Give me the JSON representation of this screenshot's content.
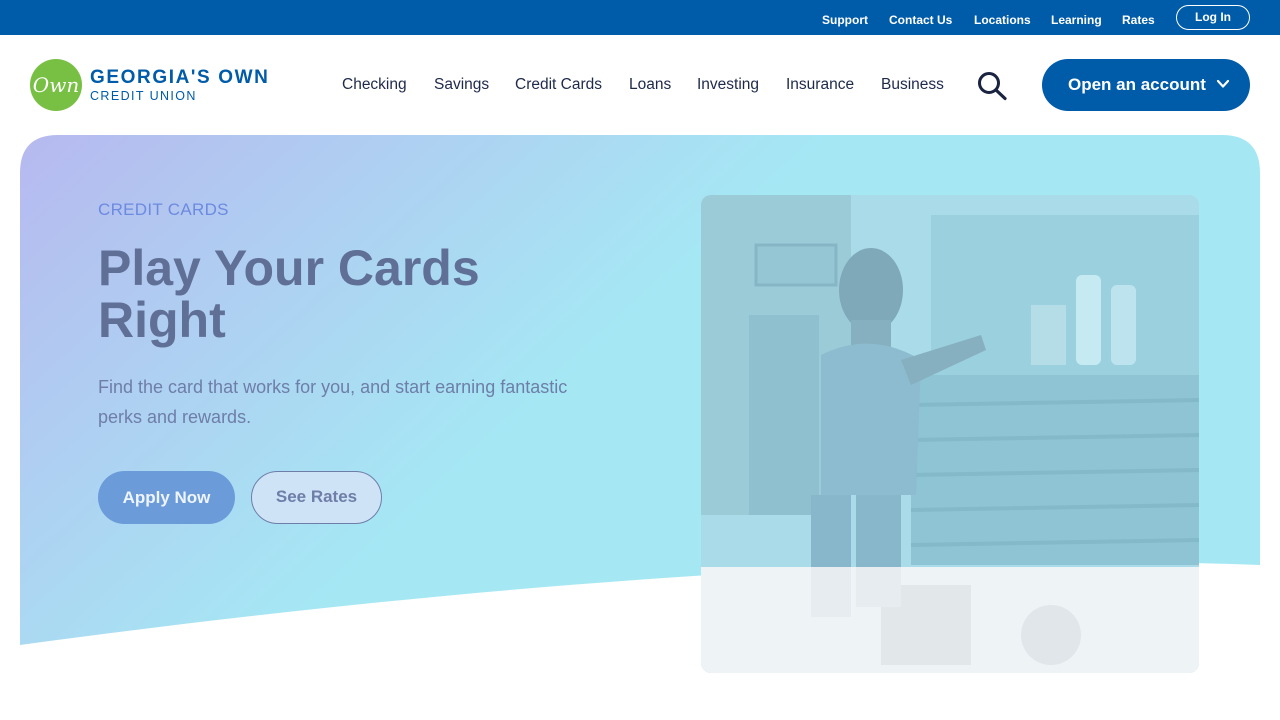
{
  "utility_nav": {
    "support": "Support",
    "contact_us": "Contact Us",
    "locations": "Locations",
    "learning": "Learning",
    "rates": "Rates",
    "log_in": "Log In"
  },
  "brand": {
    "mark": "Own",
    "name_line1": "GEORGIA'S OWN",
    "name_line2": "CREDIT UNION"
  },
  "main_nav": {
    "items": [
      {
        "label": "Checking"
      },
      {
        "label": "Savings"
      },
      {
        "label": "Credit Cards"
      },
      {
        "label": "Loans"
      },
      {
        "label": "Investing"
      },
      {
        "label": "Insurance"
      },
      {
        "label": "Business"
      }
    ],
    "search_icon": "search-icon",
    "open_account_label": "Open an account",
    "open_account_icon": "chevron-down-icon"
  },
  "hero": {
    "eyebrow": "CREDIT CARDS",
    "headline": "Play Your Cards Right",
    "subtext": "Find the card that works for you, and start earning fantastic perks and rewards.",
    "primary_cta": "Apply Now",
    "secondary_cta": "See Rates"
  },
  "colors": {
    "brand_blue": "#005ba8",
    "logo_green": "#78c043",
    "hero_gradient_start": "#b7b9ef",
    "hero_gradient_end": "#a5e8f4"
  }
}
